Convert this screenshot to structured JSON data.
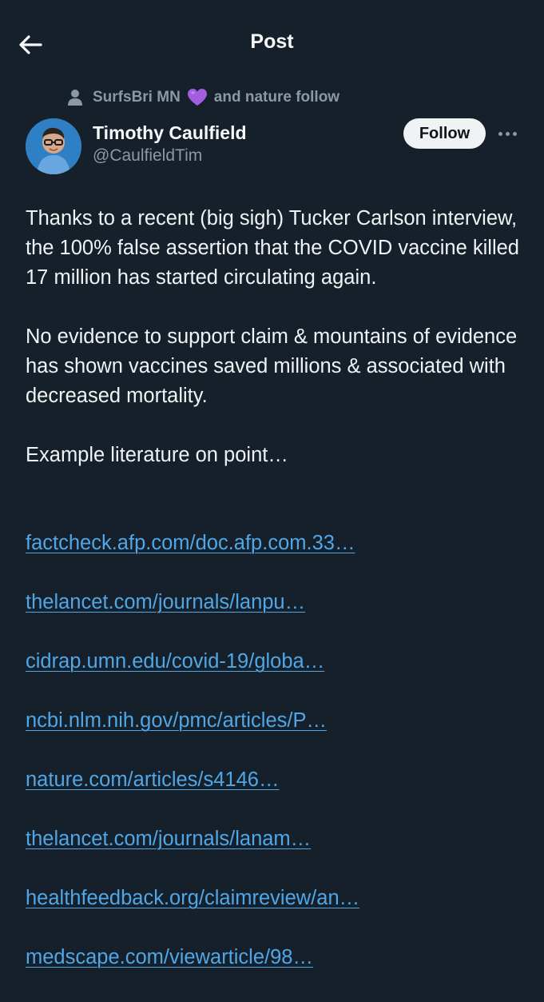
{
  "header": {
    "title": "Post",
    "back_icon": "arrow-left-icon"
  },
  "social_context": {
    "name": "SurfsBri MN",
    "emoji": "purple-heart",
    "suffix": "and nature follow"
  },
  "author": {
    "name": "Timothy Caulfield",
    "handle": "@CaulfieldTim"
  },
  "actions": {
    "follow_label": "Follow"
  },
  "post": {
    "paragraphs": [
      "Thanks to a recent (big sigh) Tucker Carlson interview, the 100% false assertion that the COVID vaccine killed 17 million has started circulating again.",
      "No evidence to support claim & mountains of evidence has shown vaccines saved millions & associated with decreased mortality.",
      "Example literature on point…"
    ],
    "links": [
      "factcheck.afp.com/doc.afp.com.33…",
      "thelancet.com/journals/lanpu…",
      "cidrap.umn.edu/covid-19/globa…",
      "ncbi.nlm.nih.gov/pmc/articles/P…",
      "nature.com/articles/s4146…",
      "thelancet.com/journals/lanam…",
      "healthfeedback.org/claimreview/an…",
      "medscape.com/viewarticle/98…"
    ]
  },
  "colors": {
    "background": "#15202b",
    "link": "#4fa7e8",
    "secondary_text": "#8b98a5",
    "heart": "#a35ee0"
  }
}
